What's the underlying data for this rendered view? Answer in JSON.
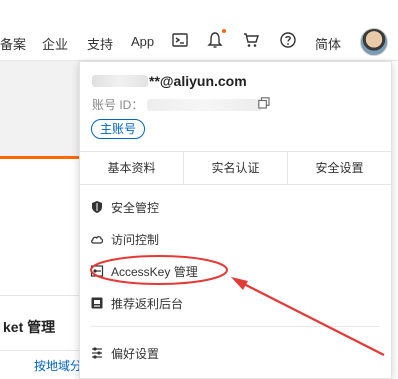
{
  "nav": {
    "items": [
      "备案",
      "企业",
      "支持",
      "App"
    ],
    "icons": [
      "terminal-icon",
      "bell-icon",
      "cart-icon",
      "help-icon"
    ],
    "lang": "简体",
    "notification_dot_color": "#ff6a00"
  },
  "background": {
    "title": "ket 管理",
    "sub_link": "按地域分"
  },
  "account": {
    "email_suffix": "**@aliyun.com",
    "id_label": "账号 ID：",
    "role_badge": "主账号"
  },
  "tabs": [
    "基本资料",
    "实名认证",
    "安全设置"
  ],
  "menu": [
    {
      "label": "安全管控",
      "icon": "shield-icon"
    },
    {
      "label": "访问控制",
      "icon": "cloud-icon"
    },
    {
      "label": "AccessKey 管理",
      "icon": "key-icon"
    },
    {
      "label": "推荐返利后台",
      "icon": "gift-icon"
    },
    {
      "label": "偏好设置",
      "icon": "settings-icon"
    }
  ],
  "colors": {
    "accent": "#ff6a00",
    "link": "#0064c8",
    "annotation": "#e53935"
  }
}
